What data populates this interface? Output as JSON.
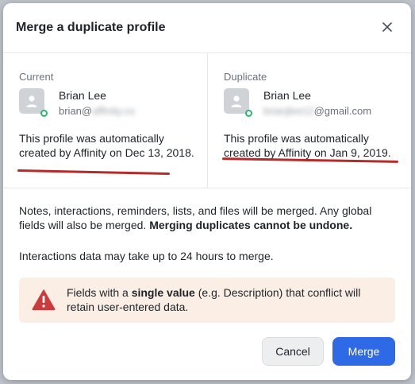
{
  "dialog": {
    "title": "Merge a duplicate profile",
    "close_icon": "close-icon"
  },
  "current": {
    "label": "Current",
    "name": "Brian Lee",
    "email_visible": "brian@",
    "email_blurred": "affinity.co",
    "description": "This profile was automatically created by Affinity on Dec 13, 2018."
  },
  "duplicate": {
    "label": "Duplicate",
    "name": "Brian Lee",
    "email_blurred": "brianjlee12",
    "email_visible": "@gmail.com",
    "description": "This profile was automatically created by Affinity on Jan 9, 2019."
  },
  "info": {
    "line1_normal": "Notes, interactions, reminders, lists, and files will be merged. Any global fields will also be merged. ",
    "line1_strong": "Merging duplicates cannot be undone.",
    "line2": "Interactions data may take up to 24 hours to merge."
  },
  "warning": {
    "icon": "warning-icon",
    "pre": "Fields with a ",
    "strong": "single value",
    "post": " (e.g. Description) that conflict will retain user-entered data."
  },
  "buttons": {
    "cancel": "Cancel",
    "merge": "Merge"
  },
  "colors": {
    "primary": "#2f6ae6",
    "warning_bg": "#fbeee4",
    "warning_icon": "#cc3b3b",
    "annotation_underline": "#b52b2b",
    "status_dot": "#2bb673"
  }
}
